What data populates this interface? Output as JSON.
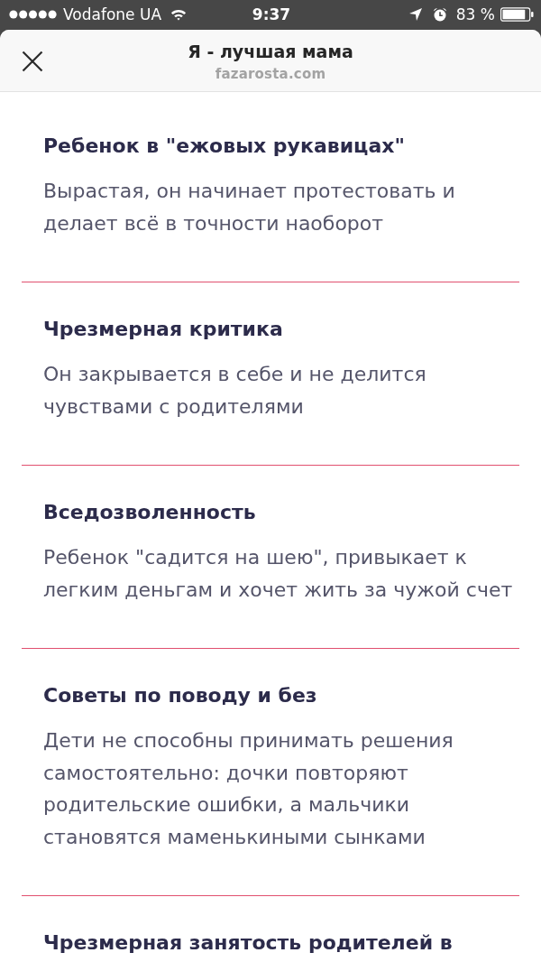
{
  "status_bar": {
    "carrier": "Vodafone UA",
    "time": "9:37",
    "battery": "83 %"
  },
  "header": {
    "title": "Я - лучшая мама",
    "subtitle": "fazarosta.com"
  },
  "sections": [
    {
      "heading": "Ребенок в \"ежовых рукавицах\"",
      "text": "Вырастая, он начинает протестовать и делает всё в точности наоборот"
    },
    {
      "heading": "Чрезмерная критика",
      "text": "Он закрывается в себе и не делится чувствами с родителями"
    },
    {
      "heading": "Вседозволенность",
      "text": "Ребенок \"садится на шею\", привыкает к легким деньгам и хочет жить за чужой счет"
    },
    {
      "heading": "Советы по поводу и без",
      "text": "Дети не способны принимать решения самостоятельно: дочки повторяют родительские ошибки, а мальчики становятся маменькиными сынками"
    },
    {
      "heading": "Чрезмерная занятость родителей в"
    }
  ]
}
